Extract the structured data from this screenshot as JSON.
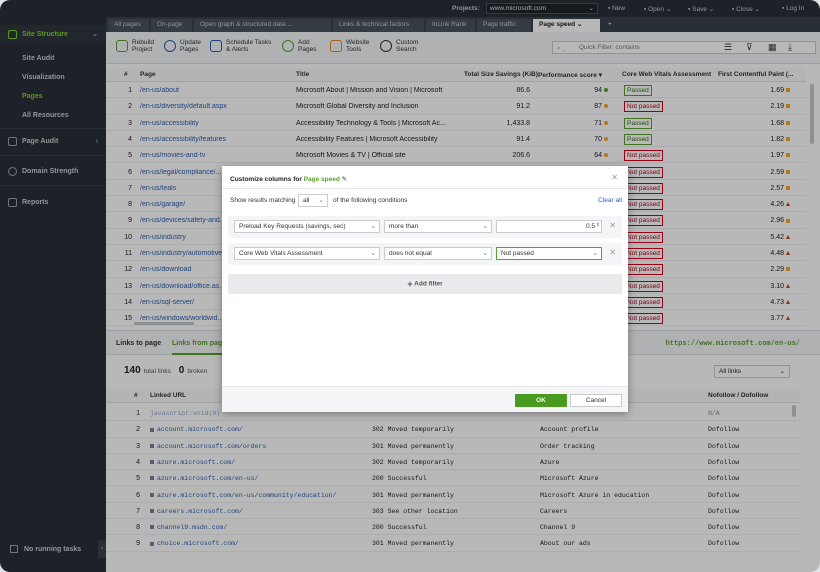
{
  "sidebar": {
    "items": [
      {
        "label": "Site Structure"
      },
      {
        "label": "Page Audit"
      },
      {
        "label": "Domain Strength"
      },
      {
        "label": "Reports"
      }
    ],
    "sub_items": [
      {
        "label": "Site Audit"
      },
      {
        "label": "Visualization"
      },
      {
        "label": "Pages"
      },
      {
        "label": "All Resources"
      }
    ],
    "bottom_label": "No running tasks"
  },
  "topbar": {
    "projects_label": "Projects:",
    "project_value": "www.microsoft.com",
    "new_label": "New",
    "open_label": "Open",
    "save_label": "Save",
    "close_label": "Close",
    "login_label": "Log In"
  },
  "tabs": [
    {
      "label": "All pages"
    },
    {
      "label": "On-page"
    },
    {
      "label": "Open graph & structured data ..."
    },
    {
      "label": "Links & technical factors"
    },
    {
      "label": "InLink Rank"
    },
    {
      "label": "Page traffic"
    },
    {
      "label": "Page speed"
    },
    {
      "label": "+"
    }
  ],
  "toolbar": {
    "rebuild": "Rebuild\nProject",
    "update": "Update\nPages",
    "schedule": "Schedule Tasks\n& Alerts",
    "add": "Add\nPages",
    "website_tools": "Website\nTools",
    "custom_search": "Custom\nSearch",
    "quick_filter_placeholder": "Quick Filter: contains"
  },
  "table": {
    "headers": [
      "#",
      "Page",
      "Title",
      "Total Size Savings (KiB)",
      "Performance score ▾",
      "Core Web Vitals Assessment",
      "First Contentful Paint (..."
    ],
    "rows": [
      {
        "n": "1",
        "page": "/en-us/about",
        "title": "Microsoft About | Mission and Vision | Microsoft",
        "savings": "86.6",
        "score": "94",
        "score_color": "#5aa02c",
        "cwv": "Passed",
        "cwv_state": "p",
        "fcp": "1.69",
        "fcp_mark": "sq",
        "fcp_color": "#f5a623"
      },
      {
        "n": "2",
        "page": "/en-us/diversity/default.aspx",
        "title": "Microsoft Global Diversity and Inclusion",
        "savings": "91.2",
        "score": "87",
        "score_color": "#f5a623",
        "cwv": "Not passed",
        "cwv_state": "f",
        "fcp": "2.19",
        "fcp_mark": "sq",
        "fcp_color": "#f5a623"
      },
      {
        "n": "3",
        "page": "/en-us/accessibility",
        "title": "Accessibility Technology & Tools | Microsoft Ac...",
        "savings": "1,433.8",
        "score": "71",
        "score_color": "#f5a623",
        "cwv": "Passed",
        "cwv_state": "p",
        "fcp": "1.68",
        "fcp_mark": "sq",
        "fcp_color": "#f5a623"
      },
      {
        "n": "4",
        "page": "/en-us/accessibility/features",
        "title": "Accessibility Features | Microsoft Accessibility",
        "savings": "91.4",
        "score": "70",
        "score_color": "#f5a623",
        "cwv": "Passed",
        "cwv_state": "p",
        "fcp": "1.82",
        "fcp_mark": "sq",
        "fcp_color": "#f5a623"
      },
      {
        "n": "5",
        "page": "/en-us/movies-and-tv",
        "title": "Microsoft Movies & TV | Official site",
        "savings": "206.6",
        "score": "64",
        "score_color": "#f5a623",
        "cwv": "Not passed",
        "cwv_state": "f",
        "fcp": "1.97",
        "fcp_mark": "sq",
        "fcp_color": "#f5a623"
      },
      {
        "n": "6",
        "page": "/en-us/legal/compliance/...",
        "title": "",
        "savings": "",
        "score": "",
        "score_color": "",
        "cwv": "Not passed",
        "cwv_state": "f",
        "fcp": "2.59",
        "fcp_mark": "sq",
        "fcp_color": "#f5a623"
      },
      {
        "n": "7",
        "page": "/en-us/teals",
        "title": "",
        "savings": "",
        "score": "",
        "score_color": "",
        "cwv": "Not passed",
        "cwv_state": "f",
        "fcp": "2.57",
        "fcp_mark": "sq",
        "fcp_color": "#f5a623"
      },
      {
        "n": "8",
        "page": "/en-us/garage/",
        "title": "",
        "savings": "",
        "score": "",
        "score_color": "",
        "cwv": "Not passed",
        "cwv_state": "f",
        "fcp": "4.26",
        "fcp_mark": "tri",
        "fcp_color": "#d0450f"
      },
      {
        "n": "9",
        "page": "/en-us/devices/safety-and...",
        "title": "",
        "savings": "",
        "score": "",
        "score_color": "",
        "cwv": "Not passed",
        "cwv_state": "f",
        "fcp": "2.96",
        "fcp_mark": "sq",
        "fcp_color": "#f5a623"
      },
      {
        "n": "10",
        "page": "/en-us/industry",
        "title": "",
        "savings": "",
        "score": "",
        "score_color": "",
        "cwv": "Not passed",
        "cwv_state": "f",
        "fcp": "5.42",
        "fcp_mark": "tri",
        "fcp_color": "#d0450f"
      },
      {
        "n": "11",
        "page": "/en-us/industry/automotive",
        "title": "",
        "savings": "",
        "score": "",
        "score_color": "",
        "cwv": "Not passed",
        "cwv_state": "f",
        "fcp": "4.48",
        "fcp_mark": "tri",
        "fcp_color": "#d0450f"
      },
      {
        "n": "12",
        "page": "/en-us/download",
        "title": "",
        "savings": "",
        "score": "",
        "score_color": "",
        "cwv": "Not passed",
        "cwv_state": "f",
        "fcp": "2.29",
        "fcp_mark": "sq",
        "fcp_color": "#f5a623"
      },
      {
        "n": "13",
        "page": "/en-us/download/office.as...",
        "title": "",
        "savings": "",
        "score": "",
        "score_color": "",
        "cwv": "Not passed",
        "cwv_state": "f",
        "fcp": "3.10",
        "fcp_mark": "tri",
        "fcp_color": "#d0450f"
      },
      {
        "n": "14",
        "page": "/en-us/sql-server/",
        "title": "",
        "savings": "",
        "score": "",
        "score_color": "",
        "cwv": "Not passed",
        "cwv_state": "f",
        "fcp": "4.73",
        "fcp_mark": "tri",
        "fcp_color": "#d0450f"
      },
      {
        "n": "15",
        "page": "/en-us/windows/worldwid...",
        "title": "",
        "savings": "",
        "score": "",
        "score_color": "",
        "cwv": "Not passed",
        "cwv_state": "f",
        "fcp": "3.77",
        "fcp_mark": "tri",
        "fcp_color": "#d0450f"
      }
    ]
  },
  "bottom": {
    "tab_links_to": "Links to page",
    "tab_links_from": "Links from page",
    "url": "https://www.microsoft.com/en-us/",
    "total_links_count": "140",
    "total_links_label": "total links",
    "broken_count": "0",
    "broken_label": "broken",
    "filter_value": "All links",
    "headers": [
      "#",
      "Linked URL",
      "",
      "",
      "Nofollow / Dofollow"
    ],
    "rows": [
      {
        "n": "1",
        "url": "javascript:void(0)",
        "status": "",
        "anchor": "",
        "follow": "N/A",
        "lock": false
      },
      {
        "n": "2",
        "url": "account.microsoft.com/",
        "status": "302 Moved temporarily",
        "anchor": "Account profile",
        "follow": "Dofollow",
        "lock": true
      },
      {
        "n": "3",
        "url": "account.microsoft.com/orders",
        "status": "301 Moved permanently",
        "anchor": "Order tracking",
        "follow": "Dofollow",
        "lock": true
      },
      {
        "n": "4",
        "url": "azure.microsoft.com/",
        "status": "302 Moved temporarily",
        "anchor": "Azure",
        "follow": "Dofollow",
        "lock": true
      },
      {
        "n": "5",
        "url": "azure.microsoft.com/en-us/",
        "status": "200 Successful",
        "anchor": "Microsoft Azure",
        "follow": "Dofollow",
        "lock": true
      },
      {
        "n": "6",
        "url": "azure.microsoft.com/en-us/community/education/",
        "status": "301 Moved permanently",
        "anchor": "Microsoft Azure in education",
        "follow": "Dofollow",
        "lock": true
      },
      {
        "n": "7",
        "url": "careers.microsoft.com/",
        "status": "303 See other location",
        "anchor": "Careers",
        "follow": "Dofollow",
        "lock": true
      },
      {
        "n": "8",
        "url": "channel9.msdn.com/",
        "status": "200 Successful",
        "anchor": "Channel 9",
        "follow": "Dofollow",
        "lock": true
      },
      {
        "n": "9",
        "url": "choice.microsoft.com/",
        "status": "301 Moved permanently",
        "anchor": "About our ads",
        "follow": "Dofollow",
        "lock": true
      }
    ]
  },
  "dialog": {
    "title_prefix": "Customize columns for",
    "title_highlight": "Page speed",
    "show_label": "Show results matching",
    "match_value": "all",
    "match_suffix": "of the following conditions",
    "clear_all": "Clear all",
    "filters": [
      {
        "field": "Preload Key Requests (savings, sec)",
        "op": "more than",
        "value": "0.5"
      },
      {
        "field": "Core Web Vitals Assessment",
        "op": "does not equal",
        "value": "Not passed"
      }
    ],
    "add_filter": "Add filter",
    "ok": "OK",
    "cancel": "Cancel"
  }
}
